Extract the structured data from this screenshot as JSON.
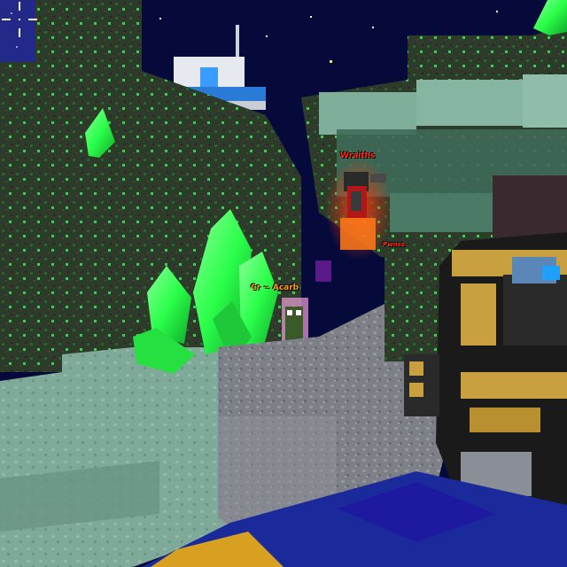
{
  "hud": {
    "crosshair_icon": "crosshair-icon"
  },
  "players": [
    {
      "name": "Wraiths",
      "color": "#ff2a1a"
    },
    {
      "name": "Cr   ~  Acarb",
      "color": "#ff9a1a"
    },
    {
      "name": "Pwnss",
      "color": "#ff2a1a"
    }
  ],
  "colors": {
    "sky": "#050a3a",
    "crystal": "#2bff4a",
    "stone": "#8a8c92",
    "moss_block": "#2e3a2a",
    "weapon_gold": "#c8a040",
    "weapon_dark": "#1a1a1a",
    "weapon_blue": "#1a2a9a"
  }
}
